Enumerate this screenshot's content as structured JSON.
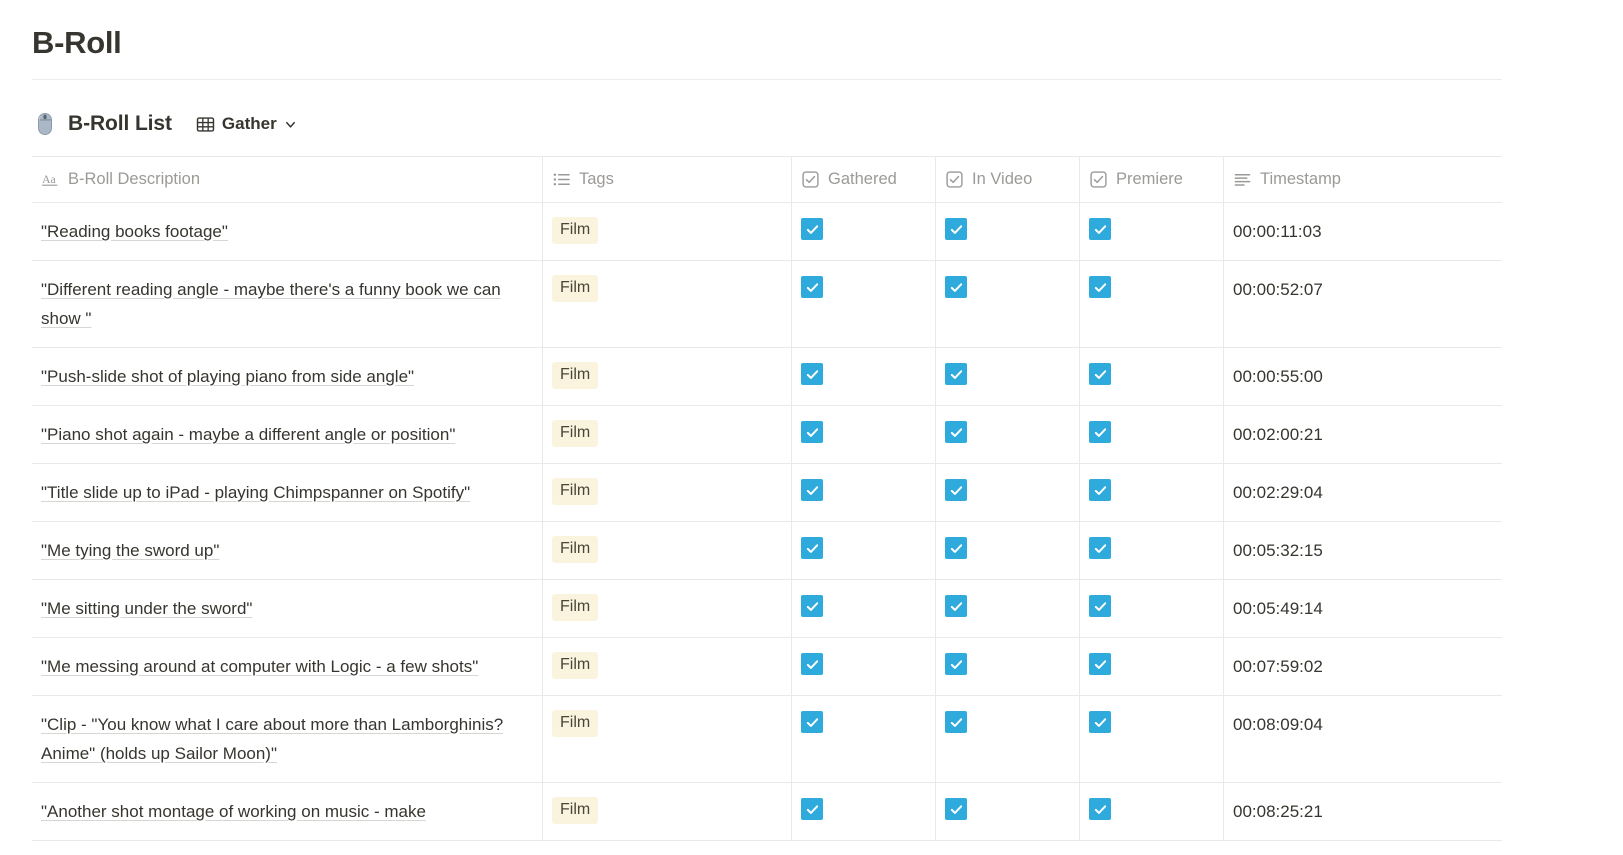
{
  "page": {
    "title": "B-Roll"
  },
  "database": {
    "emoji_icon": "computer-mouse-emoji",
    "title": "B-Roll List",
    "view": {
      "icon": "table-grid-icon",
      "label": "Gather",
      "chevron": "chevron-down-icon"
    }
  },
  "table": {
    "columns": [
      {
        "key": "description",
        "label": "B-Roll Description",
        "icon": "title-text-icon",
        "type": "title"
      },
      {
        "key": "tags",
        "label": "Tags",
        "icon": "multi-select-icon",
        "type": "multi_select"
      },
      {
        "key": "gathered",
        "label": "Gathered",
        "icon": "checkbox-icon",
        "type": "checkbox"
      },
      {
        "key": "in_video",
        "label": "In Video",
        "icon": "checkbox-icon",
        "type": "checkbox"
      },
      {
        "key": "premiere",
        "label": "Premiere",
        "icon": "checkbox-icon",
        "type": "checkbox"
      },
      {
        "key": "timestamp",
        "label": "Timestamp",
        "icon": "text-lines-icon",
        "type": "text"
      }
    ],
    "rows": [
      {
        "description": "\"Reading books footage\"",
        "tags": [
          "Film"
        ],
        "gathered": true,
        "in_video": true,
        "premiere": true,
        "timestamp": "00:00:11:03"
      },
      {
        "description": "\"Different reading angle - maybe there's a funny book we can show \"",
        "tags": [
          "Film"
        ],
        "gathered": true,
        "in_video": true,
        "premiere": true,
        "timestamp": "00:00:52:07"
      },
      {
        "description": "\"Push-slide shot of playing piano from side angle\"",
        "tags": [
          "Film"
        ],
        "gathered": true,
        "in_video": true,
        "premiere": true,
        "timestamp": "00:00:55:00"
      },
      {
        "description": "\"Piano shot again - maybe a different angle or position\"",
        "tags": [
          "Film"
        ],
        "gathered": true,
        "in_video": true,
        "premiere": true,
        "timestamp": "00:02:00:21"
      },
      {
        "description": "\"Title slide up to iPad - playing Chimpspanner on Spotify\"",
        "tags": [
          "Film"
        ],
        "gathered": true,
        "in_video": true,
        "premiere": true,
        "timestamp": "00:02:29:04"
      },
      {
        "description": "\"Me tying the sword up\"",
        "tags": [
          "Film"
        ],
        "gathered": true,
        "in_video": true,
        "premiere": true,
        "timestamp": "00:05:32:15"
      },
      {
        "description": "\"Me sitting under the sword\"",
        "tags": [
          "Film"
        ],
        "gathered": true,
        "in_video": true,
        "premiere": true,
        "timestamp": "00:05:49:14"
      },
      {
        "description": "\"Me messing around at computer with Logic - a few shots\"",
        "tags": [
          "Film"
        ],
        "gathered": true,
        "in_video": true,
        "premiere": true,
        "timestamp": "00:07:59:02"
      },
      {
        "description": "\"Clip - \"You know what I care about more than Lamborghinis? Anime\" (holds up Sailor Moon)\"",
        "tags": [
          "Film"
        ],
        "gathered": true,
        "in_video": true,
        "premiere": true,
        "timestamp": "00:08:09:04"
      },
      {
        "description": "\"Another shot montage of working on music - make",
        "tags": [
          "Film"
        ],
        "gathered": true,
        "in_video": true,
        "premiere": true,
        "timestamp": "00:08:25:21"
      }
    ]
  },
  "colors": {
    "checkbox_checked": "#2EAADC",
    "tag_background": "#FAF3DD",
    "text_primary": "#37352F",
    "text_muted": "#9B9A97",
    "border": "#E9E9E7"
  }
}
